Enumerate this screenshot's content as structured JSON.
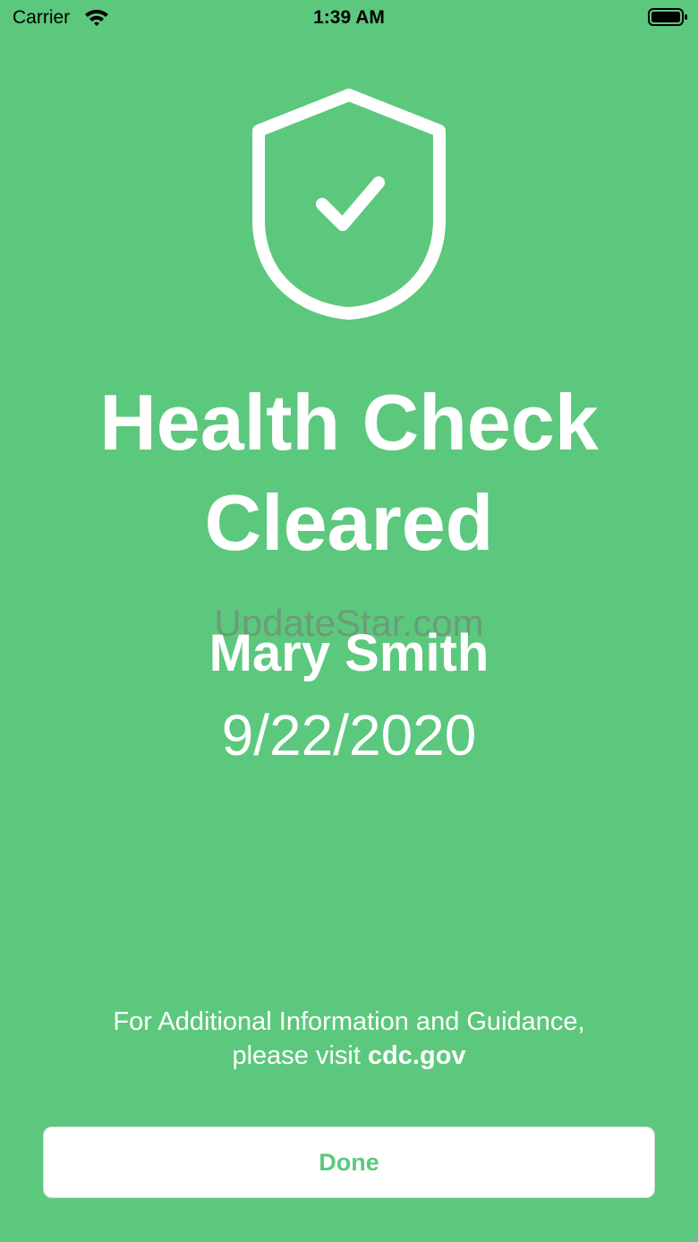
{
  "colors": {
    "background": "#5cc87d",
    "foreground": "#ffffff",
    "button_text": "#5cc87d",
    "status_bar_text": "#000000"
  },
  "status_bar": {
    "carrier": "Carrier",
    "time": "1:39 AM",
    "wifi_icon": "wifi-icon",
    "battery_icon": "battery-full-icon"
  },
  "hero": {
    "icon": "shield-check-icon"
  },
  "title": {
    "line1": "Health Check",
    "line2": "Cleared"
  },
  "watermark": "UpdateStar.com",
  "person": {
    "name": "Mary Smith",
    "date": "9/22/2020"
  },
  "info": {
    "line1": "For Additional Information and Guidance,",
    "line2_prefix": "please visit ",
    "link_text": "cdc.gov"
  },
  "actions": {
    "done_label": "Done"
  }
}
